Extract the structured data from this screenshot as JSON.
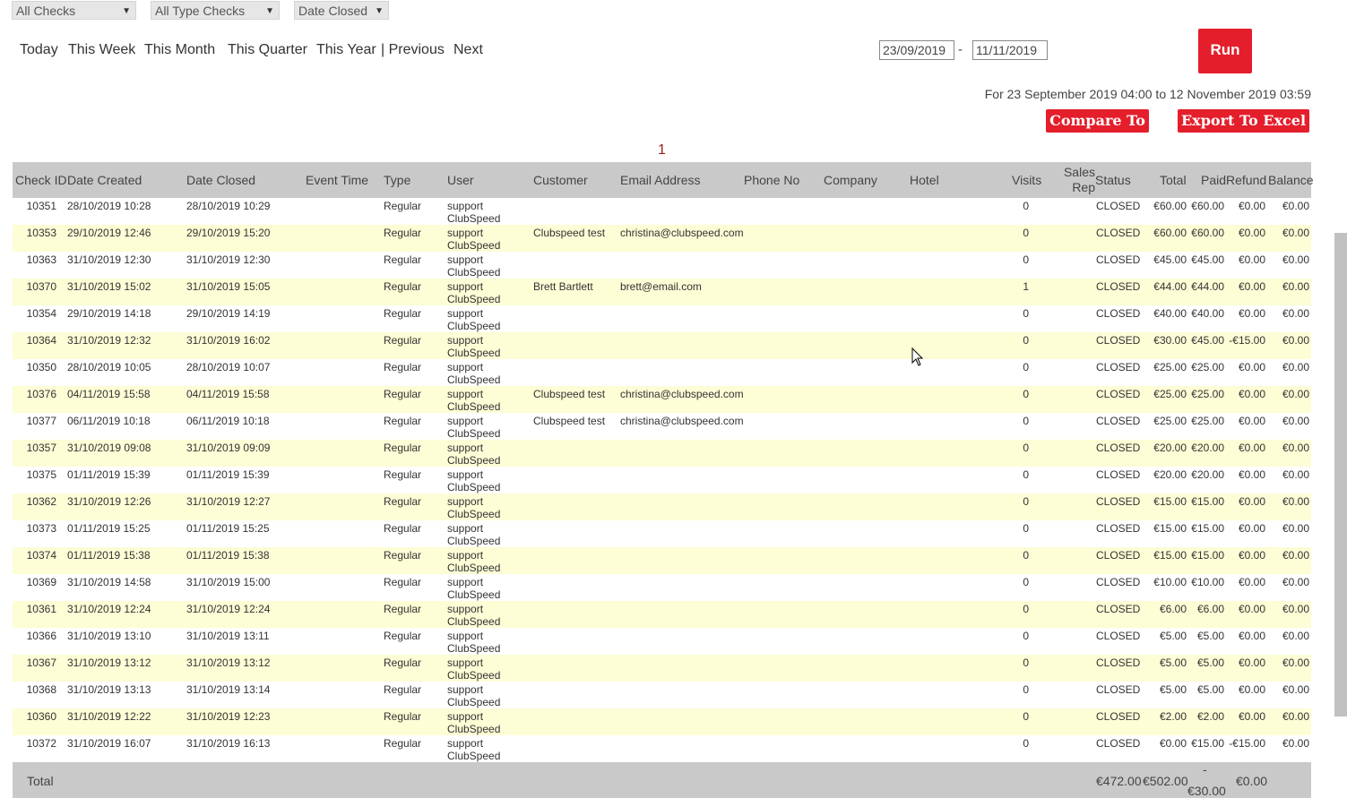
{
  "filters": {
    "checks": "All Checks",
    "type_checks": "All Type Checks",
    "date_mode": "Date Closed"
  },
  "quick_ranges": [
    "Today",
    "This Week",
    "This Month",
    "This Quarter",
    "This Year",
    "| Previous",
    "Next"
  ],
  "date_from": "23/09/2019",
  "date_sep": "-",
  "date_to": "11/11/2019",
  "run_label": "Run",
  "range_text": "For 23 September 2019 04:00 to 12 November 2019 03:59",
  "compare_label": "Compare To",
  "export_label": "Export To Excel",
  "page_number": "1",
  "columns": [
    "Check ID",
    "Date Created",
    "Date Closed",
    "Event Time",
    "Type",
    "User",
    "Customer",
    "Email Address",
    "Phone No",
    "Company",
    "Hotel",
    "Visits",
    "Sales Rep",
    "Status",
    "Total",
    "Paid",
    "Refund",
    "Balance"
  ],
  "rows": [
    {
      "id": "10351",
      "created": "28/10/2019 10:28",
      "closed": "28/10/2019 10:29",
      "type": "Regular",
      "user1": "support",
      "user2": "ClubSpeed",
      "customer": "",
      "email": "",
      "visits": "0",
      "status": "CLOSED",
      "total": "€60.00",
      "paid": "€60.00",
      "refund": "€0.00",
      "balance": "€0.00"
    },
    {
      "id": "10353",
      "created": "29/10/2019 12:46",
      "closed": "29/10/2019 15:20",
      "type": "Regular",
      "user1": "support",
      "user2": "ClubSpeed",
      "customer": "Clubspeed test",
      "email": "christina@clubspeed.com",
      "visits": "0",
      "status": "CLOSED",
      "total": "€60.00",
      "paid": "€60.00",
      "refund": "€0.00",
      "balance": "€0.00"
    },
    {
      "id": "10363",
      "created": "31/10/2019 12:30",
      "closed": "31/10/2019 12:30",
      "type": "Regular",
      "user1": "support",
      "user2": "ClubSpeed",
      "customer": "",
      "email": "",
      "visits": "0",
      "status": "CLOSED",
      "total": "€45.00",
      "paid": "€45.00",
      "refund": "€0.00",
      "balance": "€0.00"
    },
    {
      "id": "10370",
      "created": "31/10/2019 15:02",
      "closed": "31/10/2019 15:05",
      "type": "Regular",
      "user1": "support",
      "user2": "ClubSpeed",
      "customer": "Brett Bartlett",
      "email": "brett@email.com",
      "visits": "1",
      "status": "CLOSED",
      "total": "€44.00",
      "paid": "€44.00",
      "refund": "€0.00",
      "balance": "€0.00"
    },
    {
      "id": "10354",
      "created": "29/10/2019 14:18",
      "closed": "29/10/2019 14:19",
      "type": "Regular",
      "user1": "support",
      "user2": "ClubSpeed",
      "customer": "",
      "email": "",
      "visits": "0",
      "status": "CLOSED",
      "total": "€40.00",
      "paid": "€40.00",
      "refund": "€0.00",
      "balance": "€0.00"
    },
    {
      "id": "10364",
      "created": "31/10/2019 12:32",
      "closed": "31/10/2019 16:02",
      "type": "Regular",
      "user1": "support",
      "user2": "ClubSpeed",
      "customer": "",
      "email": "",
      "visits": "0",
      "status": "CLOSED",
      "total": "€30.00",
      "paid": "€45.00",
      "refund": "-€15.00",
      "balance": "€0.00"
    },
    {
      "id": "10350",
      "created": "28/10/2019 10:05",
      "closed": "28/10/2019 10:07",
      "type": "Regular",
      "user1": "support",
      "user2": "ClubSpeed",
      "customer": "",
      "email": "",
      "visits": "0",
      "status": "CLOSED",
      "total": "€25.00",
      "paid": "€25.00",
      "refund": "€0.00",
      "balance": "€0.00"
    },
    {
      "id": "10376",
      "created": "04/11/2019 15:58",
      "closed": "04/11/2019 15:58",
      "type": "Regular",
      "user1": "support",
      "user2": "ClubSpeed",
      "customer": "Clubspeed test",
      "email": "christina@clubspeed.com",
      "visits": "0",
      "status": "CLOSED",
      "total": "€25.00",
      "paid": "€25.00",
      "refund": "€0.00",
      "balance": "€0.00"
    },
    {
      "id": "10377",
      "created": "06/11/2019 10:18",
      "closed": "06/11/2019 10:18",
      "type": "Regular",
      "user1": "support",
      "user2": "ClubSpeed",
      "customer": "Clubspeed test",
      "email": "christina@clubspeed.com",
      "visits": "0",
      "status": "CLOSED",
      "total": "€25.00",
      "paid": "€25.00",
      "refund": "€0.00",
      "balance": "€0.00"
    },
    {
      "id": "10357",
      "created": "31/10/2019 09:08",
      "closed": "31/10/2019 09:09",
      "type": "Regular",
      "user1": "support",
      "user2": "ClubSpeed",
      "customer": "",
      "email": "",
      "visits": "0",
      "status": "CLOSED",
      "total": "€20.00",
      "paid": "€20.00",
      "refund": "€0.00",
      "balance": "€0.00"
    },
    {
      "id": "10375",
      "created": "01/11/2019 15:39",
      "closed": "01/11/2019 15:39",
      "type": "Regular",
      "user1": "support",
      "user2": "ClubSpeed",
      "customer": "",
      "email": "",
      "visits": "0",
      "status": "CLOSED",
      "total": "€20.00",
      "paid": "€20.00",
      "refund": "€0.00",
      "balance": "€0.00"
    },
    {
      "id": "10362",
      "created": "31/10/2019 12:26",
      "closed": "31/10/2019 12:27",
      "type": "Regular",
      "user1": "support",
      "user2": "ClubSpeed",
      "customer": "",
      "email": "",
      "visits": "0",
      "status": "CLOSED",
      "total": "€15.00",
      "paid": "€15.00",
      "refund": "€0.00",
      "balance": "€0.00"
    },
    {
      "id": "10373",
      "created": "01/11/2019 15:25",
      "closed": "01/11/2019 15:25",
      "type": "Regular",
      "user1": "support",
      "user2": "ClubSpeed",
      "customer": "",
      "email": "",
      "visits": "0",
      "status": "CLOSED",
      "total": "€15.00",
      "paid": "€15.00",
      "refund": "€0.00",
      "balance": "€0.00"
    },
    {
      "id": "10374",
      "created": "01/11/2019 15:38",
      "closed": "01/11/2019 15:38",
      "type": "Regular",
      "user1": "support",
      "user2": "ClubSpeed",
      "customer": "",
      "email": "",
      "visits": "0",
      "status": "CLOSED",
      "total": "€15.00",
      "paid": "€15.00",
      "refund": "€0.00",
      "balance": "€0.00"
    },
    {
      "id": "10369",
      "created": "31/10/2019 14:58",
      "closed": "31/10/2019 15:00",
      "type": "Regular",
      "user1": "support",
      "user2": "ClubSpeed",
      "customer": "",
      "email": "",
      "visits": "0",
      "status": "CLOSED",
      "total": "€10.00",
      "paid": "€10.00",
      "refund": "€0.00",
      "balance": "€0.00"
    },
    {
      "id": "10361",
      "created": "31/10/2019 12:24",
      "closed": "31/10/2019 12:24",
      "type": "Regular",
      "user1": "support",
      "user2": "ClubSpeed",
      "customer": "",
      "email": "",
      "visits": "0",
      "status": "CLOSED",
      "total": "€6.00",
      "paid": "€6.00",
      "refund": "€0.00",
      "balance": "€0.00"
    },
    {
      "id": "10366",
      "created": "31/10/2019 13:10",
      "closed": "31/10/2019 13:11",
      "type": "Regular",
      "user1": "support",
      "user2": "ClubSpeed",
      "customer": "",
      "email": "",
      "visits": "0",
      "status": "CLOSED",
      "total": "€5.00",
      "paid": "€5.00",
      "refund": "€0.00",
      "balance": "€0.00"
    },
    {
      "id": "10367",
      "created": "31/10/2019 13:12",
      "closed": "31/10/2019 13:12",
      "type": "Regular",
      "user1": "support",
      "user2": "ClubSpeed",
      "customer": "",
      "email": "",
      "visits": "0",
      "status": "CLOSED",
      "total": "€5.00",
      "paid": "€5.00",
      "refund": "€0.00",
      "balance": "€0.00"
    },
    {
      "id": "10368",
      "created": "31/10/2019 13:13",
      "closed": "31/10/2019 13:14",
      "type": "Regular",
      "user1": "support",
      "user2": "ClubSpeed",
      "customer": "",
      "email": "",
      "visits": "0",
      "status": "CLOSED",
      "total": "€5.00",
      "paid": "€5.00",
      "refund": "€0.00",
      "balance": "€0.00"
    },
    {
      "id": "10360",
      "created": "31/10/2019 12:22",
      "closed": "31/10/2019 12:23",
      "type": "Regular",
      "user1": "support",
      "user2": "ClubSpeed",
      "customer": "",
      "email": "",
      "visits": "0",
      "status": "CLOSED",
      "total": "€2.00",
      "paid": "€2.00",
      "refund": "€0.00",
      "balance": "€0.00"
    },
    {
      "id": "10372",
      "created": "31/10/2019 16:07",
      "closed": "31/10/2019 16:13",
      "type": "Regular",
      "user1": "support",
      "user2": "ClubSpeed",
      "customer": "",
      "email": "",
      "visits": "0",
      "status": "CLOSED",
      "total": "€0.00",
      "paid": "€15.00",
      "refund": "-€15.00",
      "balance": "€0.00"
    }
  ],
  "totals": {
    "label": "Total",
    "total": "€472.00",
    "paid": "€502.00",
    "refund_sign": "-",
    "refund": "€30.00",
    "balance": "€0.00"
  },
  "colors": {
    "accent_red": "#e41e2b",
    "row_alt": "#fdfdd6",
    "header_bg": "#c9c9c9"
  }
}
